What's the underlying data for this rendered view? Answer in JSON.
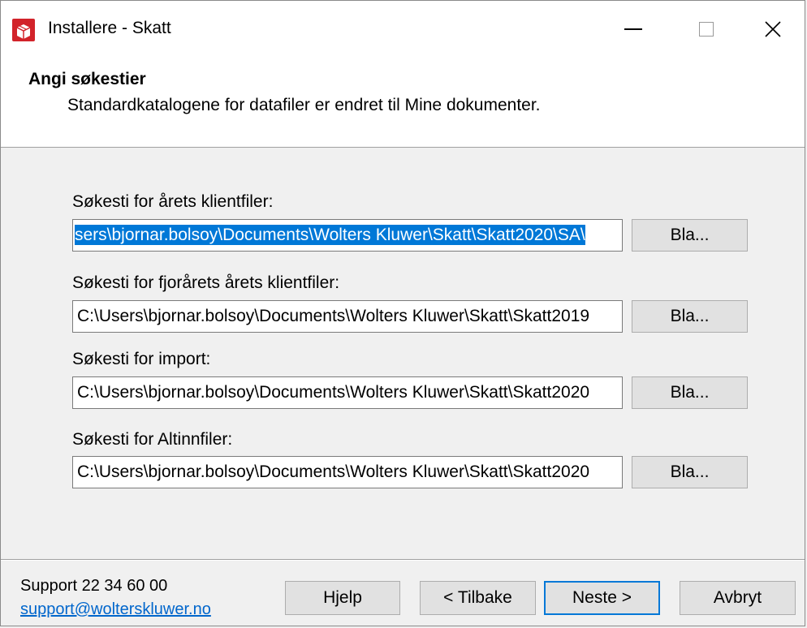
{
  "window": {
    "title": "Installere - Skatt",
    "close_glyph": "✕"
  },
  "header": {
    "title": "Angi søkestier",
    "subtitle": "Standardkatalogene for datafiler er endret til Mine dokumenter."
  },
  "fields": [
    {
      "label": "Søkesti for årets klientfiler:",
      "value": "sers\\bjornar.bolsoy\\Documents\\Wolters Kluwer\\Skatt\\Skatt2020\\SA\\",
      "selected": true,
      "button": "Bla..."
    },
    {
      "label": "Søkesti for fjorårets årets klientfiler:",
      "value": "C:\\Users\\bjornar.bolsoy\\Documents\\Wolters Kluwer\\Skatt\\Skatt2019",
      "selected": false,
      "button": "Bla..."
    },
    {
      "label": "Søkesti for import:",
      "value": "C:\\Users\\bjornar.bolsoy\\Documents\\Wolters Kluwer\\Skatt\\Skatt2020",
      "selected": false,
      "button": "Bla..."
    },
    {
      "label": "Søkesti for Altinnfiler:",
      "value": "C:\\Users\\bjornar.bolsoy\\Documents\\Wolters Kluwer\\Skatt\\Skatt2020",
      "selected": false,
      "button": "Bla..."
    }
  ],
  "footer": {
    "support_phone": "Support 22 34 60 00",
    "support_email": "support@wolterskluwer.no",
    "help": "Hjelp",
    "back": "< Tilbake",
    "next": "Neste >",
    "cancel": "Avbryt"
  },
  "icons": {
    "app": "installer-box-icon",
    "minimize": "minimize-icon",
    "maximize": "maximize-icon",
    "close": "close-icon"
  },
  "colors": {
    "selection": "#0078d7",
    "link": "#0066cc",
    "default_button_border": "#0078d7"
  }
}
